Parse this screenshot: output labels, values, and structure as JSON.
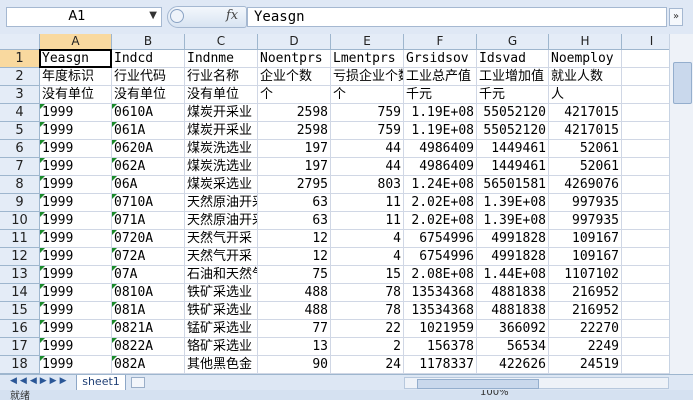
{
  "formula_bar": {
    "name_box": "A1",
    "fx_label": "fx",
    "content": "Yeasgn"
  },
  "columns": [
    "A",
    "B",
    "C",
    "D",
    "E",
    "F",
    "G",
    "H",
    "I"
  ],
  "selected_column": "A",
  "selected_row": 1,
  "rows": [
    {
      "n": "1",
      "cells": [
        "Yeasgn",
        "Indcd",
        "Indnme",
        "Noentprs",
        "Lmentprs",
        "Grsidsov",
        "Idsvad",
        "Noemploy",
        ""
      ]
    },
    {
      "n": "2",
      "cells": [
        "年度标识",
        "行业代码",
        "行业名称",
        "企业个数",
        "亏损企业个数",
        "工业总产值",
        "工业增加值",
        "就业人数",
        ""
      ]
    },
    {
      "n": "3",
      "cells": [
        "没有单位",
        "没有单位",
        "没有单位",
        "个",
        "个",
        "千元",
        "千元",
        "人",
        ""
      ]
    },
    {
      "n": "4",
      "cells": [
        "1999",
        "0610A",
        "煤炭开采业",
        "2598",
        "759",
        "1.19E+08",
        "55052120",
        "4217015",
        ""
      ]
    },
    {
      "n": "5",
      "cells": [
        "1999",
        "061A",
        "煤炭开采业",
        "2598",
        "759",
        "1.19E+08",
        "55052120",
        "4217015",
        ""
      ]
    },
    {
      "n": "6",
      "cells": [
        "1999",
        "0620A",
        "煤炭洗选业",
        "197",
        "44",
        "4986409",
        "1449461",
        "52061",
        ""
      ]
    },
    {
      "n": "7",
      "cells": [
        "1999",
        "062A",
        "煤炭洗选业",
        "197",
        "44",
        "4986409",
        "1449461",
        "52061",
        ""
      ]
    },
    {
      "n": "8",
      "cells": [
        "1999",
        "06A",
        "煤炭采选业",
        "2795",
        "803",
        "1.24E+08",
        "56501581",
        "4269076",
        ""
      ]
    },
    {
      "n": "9",
      "cells": [
        "1999",
        "0710A",
        "天然原油开采",
        "63",
        "11",
        "2.02E+08",
        "1.39E+08",
        "997935",
        ""
      ]
    },
    {
      "n": "10",
      "cells": [
        "1999",
        "071A",
        "天然原油开采",
        "63",
        "11",
        "2.02E+08",
        "1.39E+08",
        "997935",
        ""
      ]
    },
    {
      "n": "11",
      "cells": [
        "1999",
        "0720A",
        "天然气开采",
        "12",
        "4",
        "6754996",
        "4991828",
        "109167",
        ""
      ]
    },
    {
      "n": "12",
      "cells": [
        "1999",
        "072A",
        "天然气开采",
        "12",
        "4",
        "6754996",
        "4991828",
        "109167",
        ""
      ]
    },
    {
      "n": "13",
      "cells": [
        "1999",
        "07A",
        "石油和天然气",
        "75",
        "15",
        "2.08E+08",
        "1.44E+08",
        "1107102",
        ""
      ]
    },
    {
      "n": "14",
      "cells": [
        "1999",
        "0810A",
        "铁矿采选业",
        "488",
        "78",
        "13534368",
        "4881838",
        "216952",
        ""
      ]
    },
    {
      "n": "15",
      "cells": [
        "1999",
        "081A",
        "铁矿采选业",
        "488",
        "78",
        "13534368",
        "4881838",
        "216952",
        ""
      ]
    },
    {
      "n": "16",
      "cells": [
        "1999",
        "0821A",
        "锰矿采选业",
        "77",
        "22",
        "1021959",
        "366092",
        "22270",
        ""
      ]
    },
    {
      "n": "17",
      "cells": [
        "1999",
        "0822A",
        "铬矿采选业",
        "13",
        "2",
        "156378",
        "56534",
        "2249",
        ""
      ]
    },
    {
      "n": "18",
      "cells": [
        "1999",
        "082A",
        "其他黑色金",
        "90",
        "24",
        "1178337",
        "422626",
        "24519",
        ""
      ]
    },
    {
      "n": "19",
      "cells": [
        "",
        "",
        "",
        "",
        "",
        "",
        "",
        "",
        ""
      ]
    }
  ],
  "sheet_tabs": [
    {
      "label": "sheet1"
    }
  ],
  "tab_nav": "◀◀◀▶▶▶",
  "status": {
    "ready": "就绪",
    "zoom": "100%"
  }
}
